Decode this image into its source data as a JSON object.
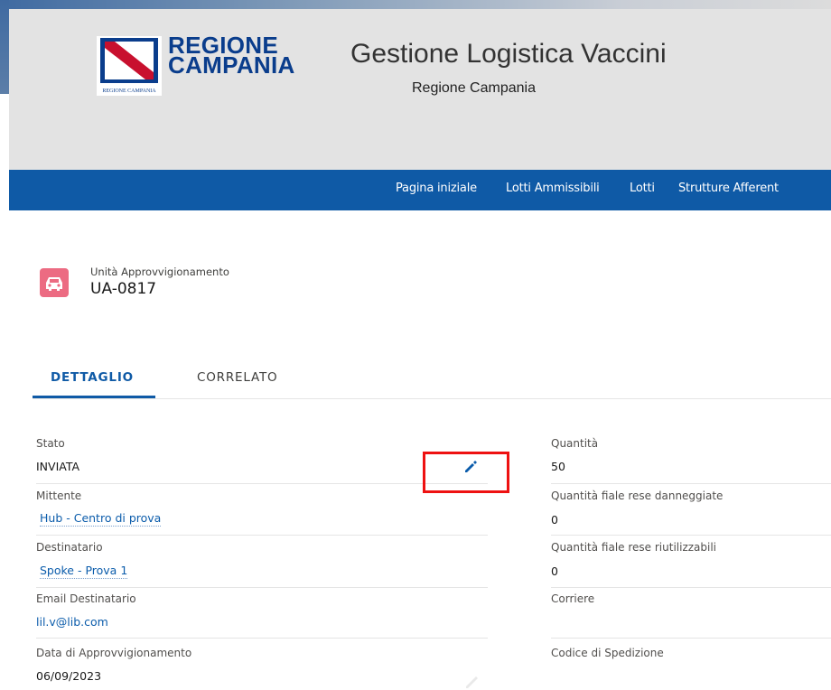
{
  "header": {
    "logo_line1": "REGIONE",
    "logo_line2": "CAMPANIA",
    "logo_caption": "REGIONE CAMPANIA",
    "app_title": "Gestione Logistica Vaccini",
    "app_subtitle": "Regione Campania"
  },
  "nav": {
    "items": [
      "Pagina iniziale",
      "Lotti Ammissibili",
      "Lotti",
      "Strutture Afferent"
    ]
  },
  "record": {
    "icon": "car-icon",
    "type_label": "Unità Approvvigionamento",
    "name": "UA-0817"
  },
  "tabs": {
    "active": "DETTAGLIO",
    "inactive": "CORRELATO"
  },
  "fields": {
    "left": [
      {
        "label": "Stato",
        "value": "INVIATA"
      },
      {
        "label": "Mittente",
        "value": "Hub - Centro di prova"
      },
      {
        "label": "Destinatario",
        "value": "Spoke - Prova 1"
      },
      {
        "label": "Email Destinatario",
        "value": "lil.v@lib.com"
      },
      {
        "label": "Data di Approvvigionamento",
        "value": "06/09/2023"
      }
    ],
    "right": [
      {
        "label": "Quantità",
        "value": "50"
      },
      {
        "label": "Quantità fiale rese danneggiate",
        "value": "0"
      },
      {
        "label": "Quantità fiale rese riutilizzabili",
        "value": "0"
      },
      {
        "label": "Corriere",
        "value": ""
      },
      {
        "label": "Codice di Spedizione",
        "value": ""
      }
    ]
  },
  "colors": {
    "brand_blue": "#0f5aa6",
    "header_bg": "#e3e3e3",
    "record_icon_bg": "#ec6b82",
    "highlight": "#ee1111",
    "link": "#0b5cab"
  }
}
